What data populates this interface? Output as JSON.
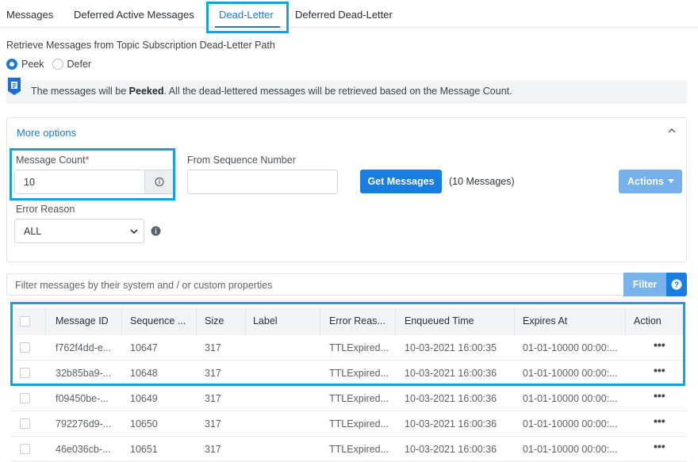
{
  "tabs": [
    {
      "label": "Messages"
    },
    {
      "label": "Deferred Active Messages"
    },
    {
      "label": "Dead-Letter"
    },
    {
      "label": "Deferred Dead-Letter"
    }
  ],
  "subtitle": "Retrieve Messages from Topic Subscription Dead-Letter Path",
  "mode": {
    "peek_label": "Peek",
    "defer_label": "Defer",
    "selected": "Peek"
  },
  "info": {
    "text_before": "The messages will be ",
    "text_bold": "Peeked",
    "text_after": ". All the dead-lettered messages will be retrieved based on the Message Count."
  },
  "more_options": {
    "title": "More options",
    "message_count_label": "Message Count",
    "required_mark": "*",
    "message_count_value": "10",
    "from_sequence_label": "From Sequence Number",
    "from_sequence_value": "",
    "get_messages_label": "Get Messages",
    "messages_count_text": "(10 Messages)",
    "actions_label": "Actions",
    "error_reason_label": "Error Reason",
    "error_reason_value": "ALL"
  },
  "filter": {
    "placeholder": "Filter messages by their system and / or custom properties",
    "button_label": "Filter"
  },
  "table": {
    "headers": [
      "Message ID",
      "Sequence ...",
      "Size",
      "Label",
      "Error Reas...",
      "Enqueued Time",
      "Expires At",
      "Action"
    ],
    "rows": [
      {
        "id": "f762f4dd-e...",
        "seq": "10647",
        "size": "317",
        "label": "",
        "error": "TTLExpired...",
        "enqueued": "10-03-2021 16:00:35",
        "expires": "01-01-10000 00:00:..."
      },
      {
        "id": "32b85ba9-...",
        "seq": "10648",
        "size": "317",
        "label": "",
        "error": "TTLExpired...",
        "enqueued": "10-03-2021 16:00:36",
        "expires": "01-01-10000 00:00:..."
      },
      {
        "id": "f09450be-...",
        "seq": "10649",
        "size": "317",
        "label": "",
        "error": "TTLExpired...",
        "enqueued": "10-03-2021 16:00:36",
        "expires": "01-01-10000 00:00:..."
      },
      {
        "id": "792276d9-...",
        "seq": "10650",
        "size": "317",
        "label": "",
        "error": "TTLExpired...",
        "enqueued": "10-03-2021 16:00:36",
        "expires": "01-01-10000 00:00:..."
      },
      {
        "id": "46e036cb-...",
        "seq": "10651",
        "size": "317",
        "label": "",
        "error": "TTLExpired...",
        "enqueued": "10-03-2021 16:00:36",
        "expires": "01-01-10000 00:00:..."
      }
    ],
    "action_glyph": "•••"
  },
  "colors": {
    "accent": "#1a7ee0",
    "highlight": "#1aa0de",
    "required": "#e0334a"
  }
}
